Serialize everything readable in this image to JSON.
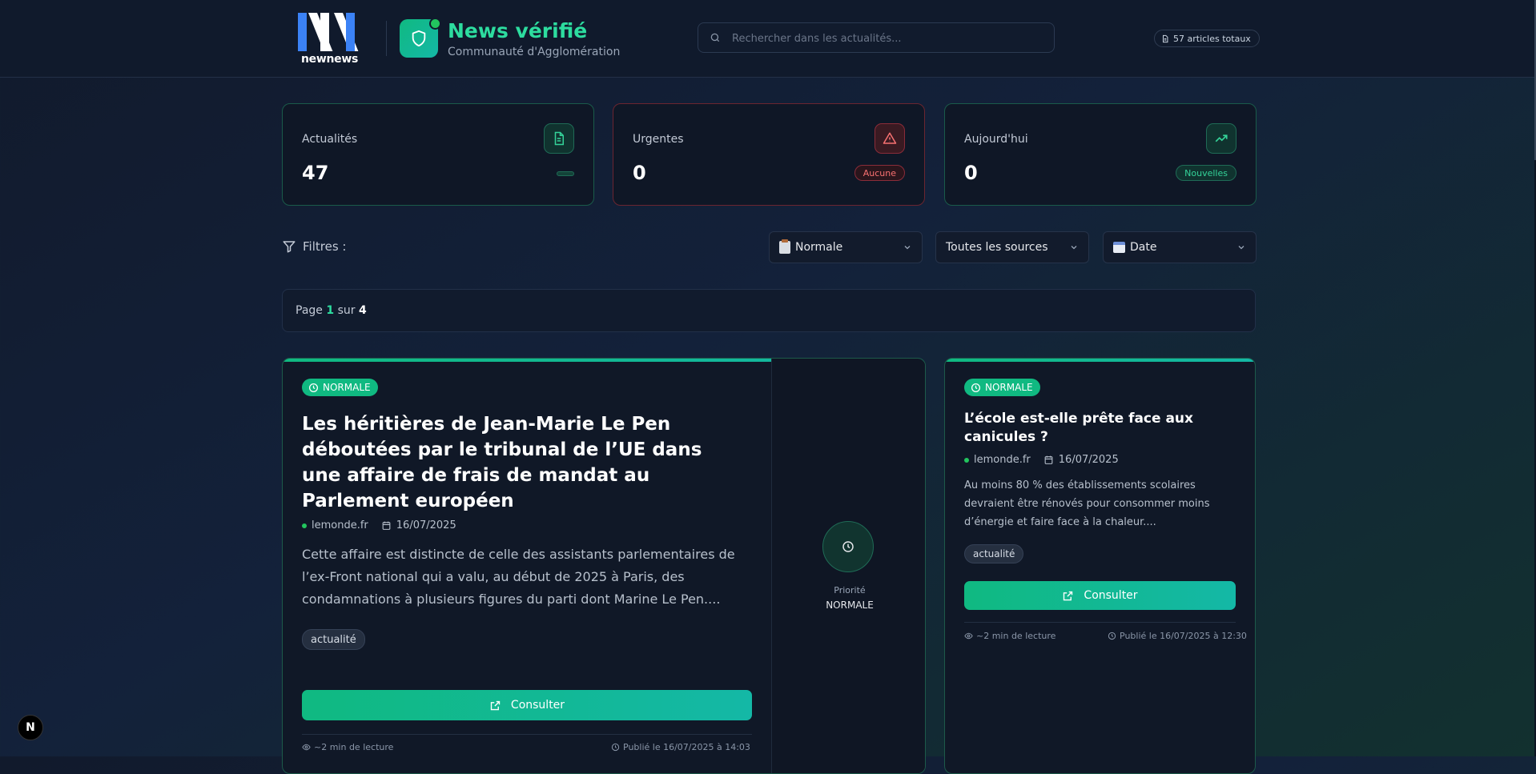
{
  "header": {
    "logo_text": "newnews",
    "brand_title": "News vérifié",
    "brand_subtitle": "Communauté d'Agglomération",
    "search_placeholder": "Rechercher dans les actualités...",
    "total_articles": "57 articles totaux"
  },
  "stats": [
    {
      "label": "Actualités",
      "value": "47",
      "pill": "",
      "icon": "document-icon",
      "accent": "#10b981"
    },
    {
      "label": "Urgentes",
      "value": "0",
      "pill": "Aucune",
      "icon": "warning-triangle-icon",
      "accent": "#ef4444"
    },
    {
      "label": "Aujourd'hui",
      "value": "0",
      "pill": "Nouvelles",
      "icon": "trending-up-icon",
      "accent": "#10b981"
    }
  ],
  "filters": {
    "label": "Filtres :",
    "priority": "Normale",
    "source": "Toutes les sources",
    "sort": "Date"
  },
  "pagination": {
    "prefix": "Page",
    "current": "1",
    "separator": "sur",
    "total": "4"
  },
  "articles": [
    {
      "badge": "NORMALE",
      "title": "Les héritières de Jean-Marie Le Pen déboutées par le tribunal de l’UE dans une affaire de frais de mandat au Parlement européen",
      "source": "lemonde.fr",
      "date": "16/07/2025",
      "description": "Cette affaire est distincte de celle des assistants parlementaires de l’ex-Front national qui a valu, au début de 2025 à Paris, des condamnations à plusieurs figures du parti dont Marine Le Pen....",
      "tag": "actualité",
      "button": "Consulter",
      "reading_time": "~2 min de lecture",
      "published": "Publié le 16/07/2025 à 14:03",
      "priority_label": "Priorité",
      "priority_value": "NORMALE"
    },
    {
      "badge": "NORMALE",
      "title": "L’école est-elle prête face aux canicules ?",
      "source": "lemonde.fr",
      "date": "16/07/2025",
      "description": "Au moins 80 % des établissements scolaires devraient être rénovés pour consommer moins d’énergie et faire face à la chaleur....",
      "tag": "actualité",
      "button": "Consulter",
      "reading_time": "~2 min de lecture",
      "published": "Publié le 16/07/2025 à 12:30"
    }
  ],
  "dev_button": "N",
  "colors": {
    "accent": "#10b981",
    "accent_text": "#2ddc9f",
    "danger": "#ef4444",
    "background": "#111a2c"
  }
}
